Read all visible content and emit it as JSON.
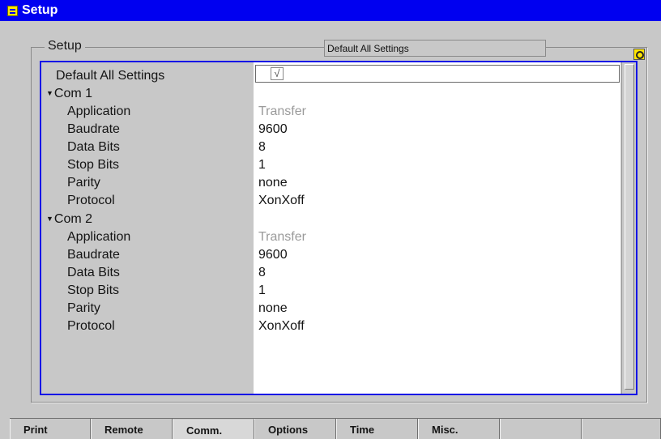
{
  "window": {
    "title": "Setup"
  },
  "frame": {
    "label": "Setup",
    "status_text": "Default All Settings"
  },
  "default_all": {
    "label": "Default All Settings",
    "checked": true,
    "check_glyph": "√"
  },
  "com1": {
    "label": "Com 1",
    "rows": [
      {
        "label": "Application",
        "value": "Transfer",
        "dim": true
      },
      {
        "label": "Baudrate",
        "value": "9600",
        "dim": false
      },
      {
        "label": "Data Bits",
        "value": "8",
        "dim": false
      },
      {
        "label": "Stop Bits",
        "value": "1",
        "dim": false
      },
      {
        "label": "Parity",
        "value": "none",
        "dim": false
      },
      {
        "label": "Protocol",
        "value": "XonXoff",
        "dim": false
      }
    ]
  },
  "com2": {
    "label": "Com 2",
    "rows": [
      {
        "label": "Application",
        "value": "Transfer",
        "dim": true
      },
      {
        "label": "Baudrate",
        "value": "9600",
        "dim": false
      },
      {
        "label": "Data Bits",
        "value": "8",
        "dim": false
      },
      {
        "label": "Stop Bits",
        "value": "1",
        "dim": false
      },
      {
        "label": "Parity",
        "value": "none",
        "dim": false
      },
      {
        "label": "Protocol",
        "value": "XonXoff",
        "dim": false
      }
    ]
  },
  "tabs": [
    {
      "label": "Print",
      "active": false
    },
    {
      "label": "Remote",
      "active": false
    },
    {
      "label": "Comm.",
      "active": true
    },
    {
      "label": "Options",
      "active": false
    },
    {
      "label": "Time",
      "active": false
    },
    {
      "label": "Misc.",
      "active": false
    },
    {
      "label": "",
      "active": false
    },
    {
      "label": "",
      "active": false
    }
  ],
  "colors": {
    "title_bar": "#0000f0",
    "panel_border": "#1414e6",
    "background": "#c8c8c8",
    "dim_text": "#9a9a9a"
  }
}
